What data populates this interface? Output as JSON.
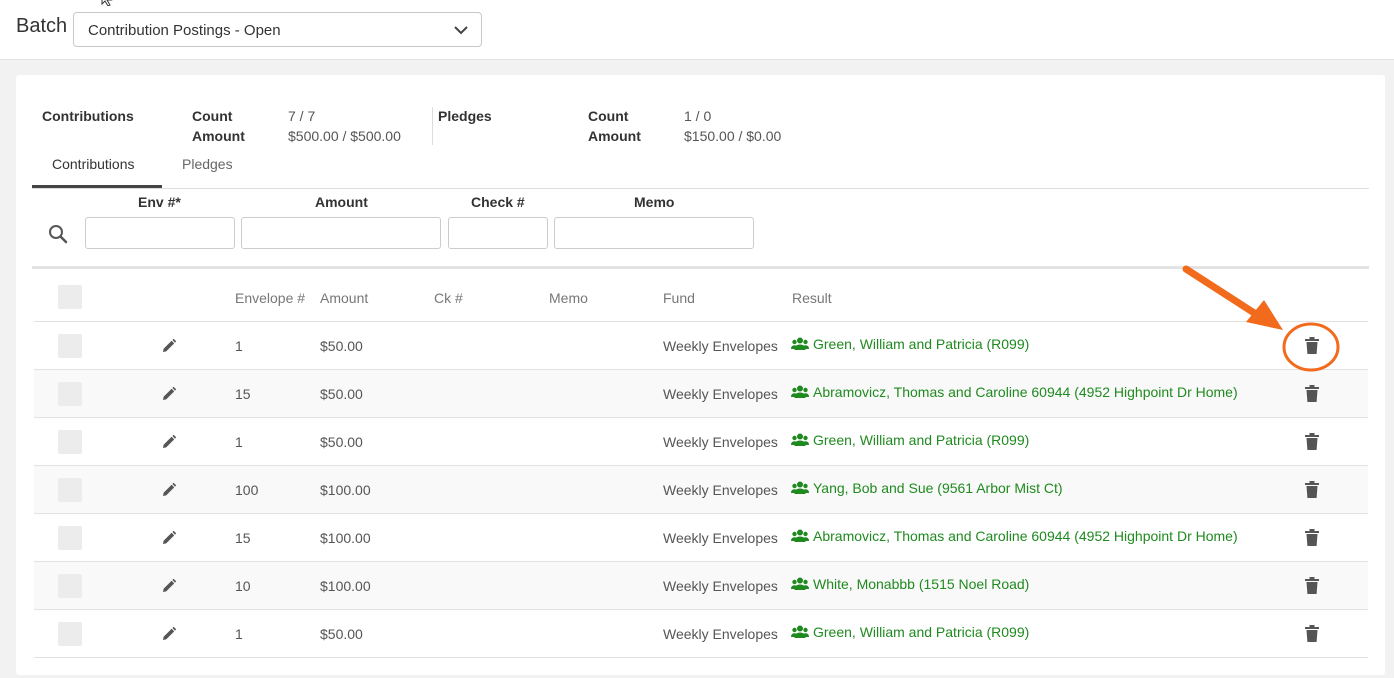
{
  "header": {
    "batch_label": "Batch",
    "batch_value": "Contribution Postings - Open"
  },
  "summary": {
    "contributions": {
      "title": "Contributions",
      "count_label": "Count",
      "count_value": "7 / 7",
      "amount_label": "Amount",
      "amount_value": "$500.00 / $500.00"
    },
    "pledges": {
      "title": "Pledges",
      "count_label": "Count",
      "count_value": "1 / 0",
      "amount_label": "Amount",
      "amount_value": "$150.00 / $0.00"
    }
  },
  "tabs": [
    {
      "label": "Contributions",
      "active": true
    },
    {
      "label": "Pledges",
      "active": false
    }
  ],
  "filters": {
    "env_label": "Env #*",
    "amount_label": "Amount",
    "check_label": "Check #",
    "memo_label": "Memo"
  },
  "table": {
    "headers": {
      "envelope": "Envelope #",
      "amount": "Amount",
      "ck": "Ck #",
      "memo": "Memo",
      "fund": "Fund",
      "result": "Result"
    },
    "rows": [
      {
        "envelope": "1",
        "amount": "$50.00",
        "ck": "",
        "memo": "",
        "fund": "Weekly Envelopes",
        "result": "Green, William and Patricia (R099)"
      },
      {
        "envelope": "15",
        "amount": "$50.00",
        "ck": "",
        "memo": "",
        "fund": "Weekly Envelopes",
        "result": "Abramovicz, Thomas and Caroline 60944 (4952 Highpoint Dr Home)"
      },
      {
        "envelope": "1",
        "amount": "$50.00",
        "ck": "",
        "memo": "",
        "fund": "Weekly Envelopes",
        "result": "Green, William and Patricia (R099)"
      },
      {
        "envelope": "100",
        "amount": "$100.00",
        "ck": "",
        "memo": "",
        "fund": "Weekly Envelopes",
        "result": "Yang, Bob and Sue (9561 Arbor Mist Ct)"
      },
      {
        "envelope": "15",
        "amount": "$100.00",
        "ck": "",
        "memo": "",
        "fund": "Weekly Envelopes",
        "result": "Abramovicz, Thomas and Caroline 60944 (4952 Highpoint Dr Home)"
      },
      {
        "envelope": "10",
        "amount": "$100.00",
        "ck": "",
        "memo": "",
        "fund": "Weekly Envelopes",
        "result": "White, Monabbb (1515 Noel Road)"
      },
      {
        "envelope": "1",
        "amount": "$50.00",
        "ck": "",
        "memo": "",
        "fund": "Weekly Envelopes",
        "result": "Green, William and Patricia (R099)"
      }
    ]
  },
  "colors": {
    "result_green": "#1f8a1f",
    "annotation_orange": "#f26b1d"
  },
  "icons": [
    "chevron-down-icon",
    "search-icon",
    "pencil-icon",
    "trash-icon",
    "people-icon"
  ]
}
